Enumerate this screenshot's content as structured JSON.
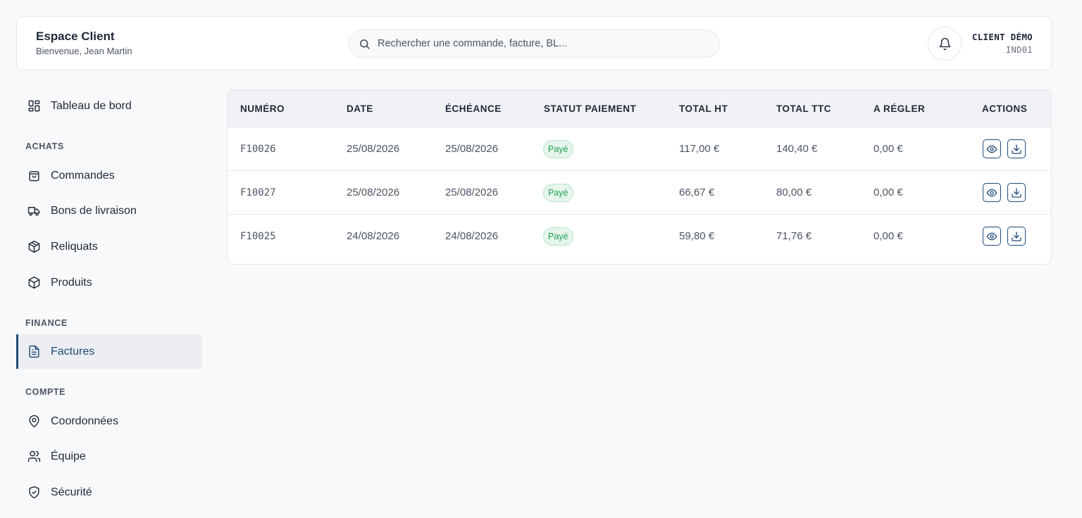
{
  "header": {
    "title": "Espace Client",
    "subtitle": "Bienvenue, Jean Martin",
    "search_placeholder": "Rechercher une commande, facture, BL...",
    "client_name": "CLIENT DÉMO",
    "client_code": "IND01"
  },
  "sidebar": {
    "dashboard": "Tableau de bord",
    "sections": {
      "achats": "ACHATS",
      "finance": "FINANCE",
      "compte": "COMPTE"
    },
    "items": {
      "commandes": "Commandes",
      "bons_livraison": "Bons de livraison",
      "reliquats": "Reliquats",
      "produits": "Produits",
      "factures": "Factures",
      "coordonnees": "Coordonnées",
      "equipe": "Équipe",
      "securite": "Sécurité"
    },
    "active": "factures"
  },
  "table": {
    "columns": [
      "NUMÉRO",
      "DATE",
      "ÉCHÉANCE",
      "STATUT PAIEMENT",
      "TOTAL HT",
      "TOTAL TTC",
      "A RÉGLER",
      "ACTIONS"
    ],
    "rows": [
      {
        "numero": "F10026",
        "date": "25/08/2026",
        "echeance": "25/08/2026",
        "statut": "Payé",
        "total_ht": "117,00 €",
        "total_ttc": "140,40 €",
        "a_regler": "0,00 €"
      },
      {
        "numero": "F10027",
        "date": "25/08/2026",
        "echeance": "25/08/2026",
        "statut": "Payé",
        "total_ht": "66,67 €",
        "total_ttc": "80,00 €",
        "a_regler": "0,00 €"
      },
      {
        "numero": "F10025",
        "date": "24/08/2026",
        "echeance": "24/08/2026",
        "statut": "Payé",
        "total_ht": "59,80 €",
        "total_ttc": "71,76 €",
        "a_regler": "0,00 €"
      }
    ]
  },
  "colors": {
    "accent": "#1e4b79",
    "paid_text": "#22a052",
    "paid_bg": "#e6f6ec",
    "background": "#f8f9fb"
  },
  "icons": {
    "search": "search-icon",
    "bell": "bell-icon",
    "view": "eye-icon",
    "download": "download-icon"
  }
}
